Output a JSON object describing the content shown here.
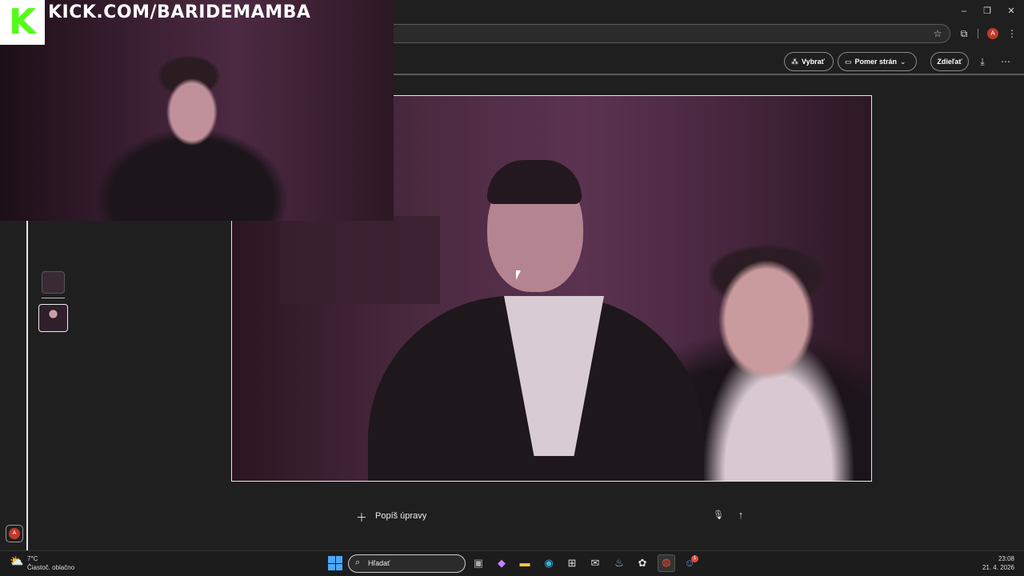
{
  "overlay": {
    "logo_letter": "K",
    "channel_url": "KICK.COM/BARIDEMAMBA"
  },
  "window_controls": {
    "minimize": "–",
    "restore": "❐",
    "close": "✕"
  },
  "browser": {
    "avatar_letter": "A",
    "icons": {
      "star": "star-icon",
      "extensions": "puzzle-icon",
      "menu": "kebab-icon"
    }
  },
  "app_toolbar": {
    "select_label": "Vybrať",
    "aspect_ratio_label": "Pomer strán",
    "share_label": "Zdieľať"
  },
  "prompt": {
    "label": "Popíš úpravy"
  },
  "profile": {
    "avatar_letter": "A"
  },
  "taskbar": {
    "weather_temp": "7°C",
    "weather_desc": "Čiastoč. oblačno",
    "search_placeholder": "Hľadať",
    "apps": [
      "task-view",
      "copilot",
      "file-explorer",
      "edge",
      "store",
      "outlook",
      "steam",
      "chatgpt",
      "chrome",
      "discord"
    ],
    "discord_badge": "1",
    "time": "23:08",
    "date": "21. 4. 2026"
  },
  "colors": {
    "kick_green": "#53fc18",
    "background": "#1f1f1f",
    "accent_red": "#c0392b"
  }
}
